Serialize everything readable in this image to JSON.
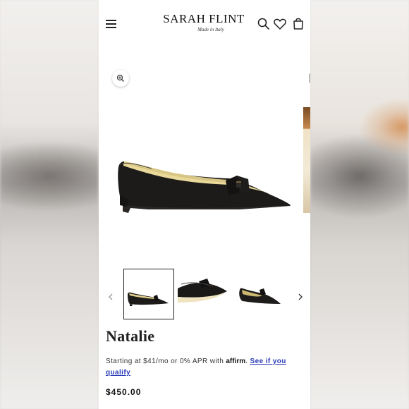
{
  "brand": {
    "name": "SARAH FLINT",
    "tagline": "Made in Italy"
  },
  "header": {
    "menu_icon": "hamburger-menu-icon",
    "search_icon": "search-icon",
    "wishlist_icon": "heart-icon",
    "cart_icon": "shopping-bag-icon"
  },
  "gallery": {
    "zoom_icon": "zoom-in-icon",
    "prev_icon": "chevron-left-icon",
    "next_icon": "chevron-right-icon",
    "thumbnails": [
      {
        "name": "side-view",
        "selected": true
      },
      {
        "name": "toe-closeup",
        "selected": false
      },
      {
        "name": "angled-view",
        "selected": false
      }
    ]
  },
  "product": {
    "title": "Natalie",
    "financing_prefix": "Starting at $41/mo or 0% APR with",
    "financing_brand": "affirm",
    "financing_suffix": ".",
    "financing_link": "See if you qualify",
    "price": "$450.00"
  },
  "colors": {
    "accent_link": "#2a3bb8",
    "text": "#111111",
    "leather": "#1c1a19",
    "lining": "#e8d99a"
  }
}
